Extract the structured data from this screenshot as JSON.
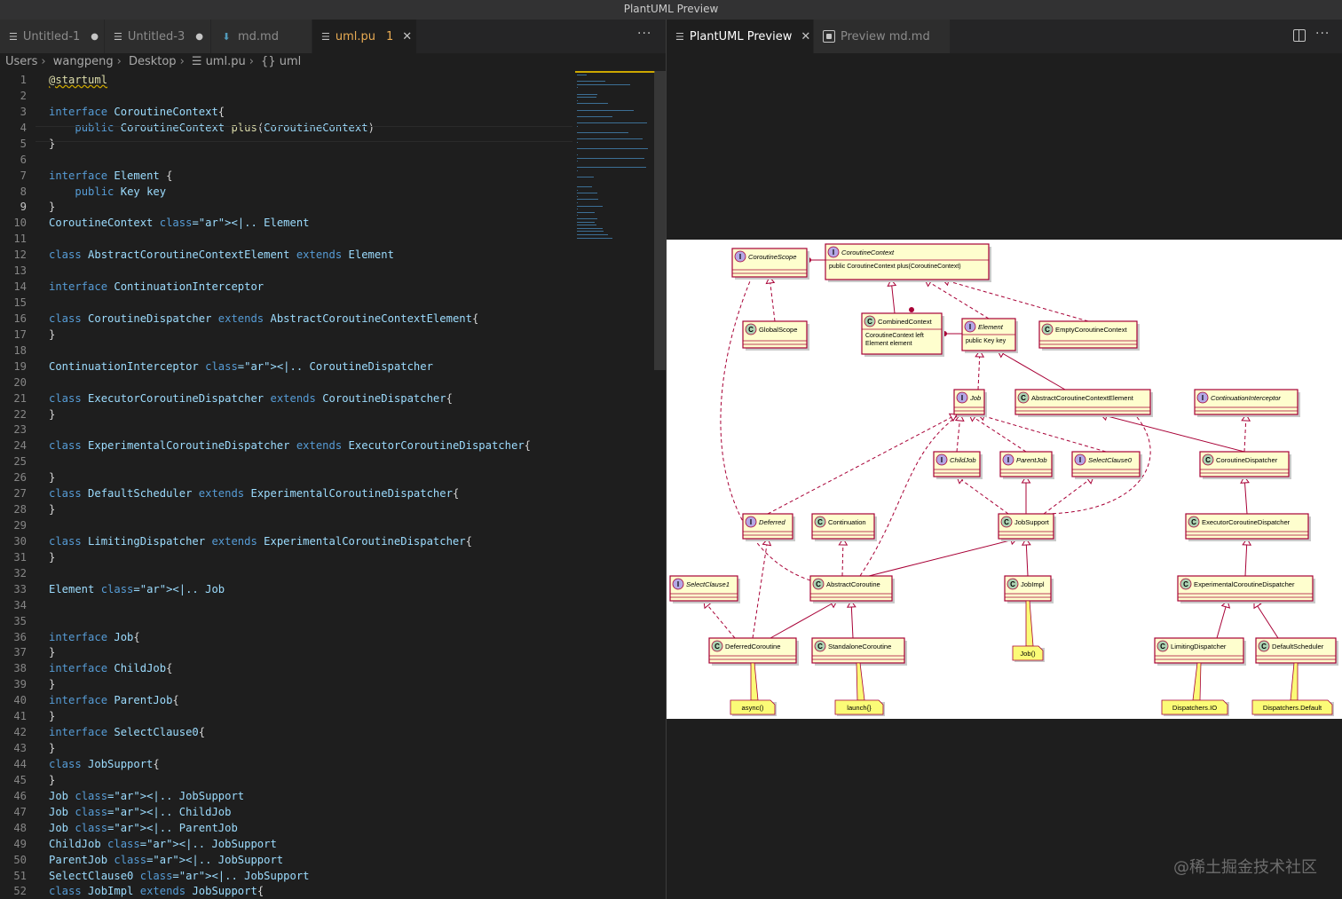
{
  "window": {
    "title": "PlantUML Preview"
  },
  "left_tabs": [
    {
      "label": "Untitled-1",
      "badge": "●"
    },
    {
      "label": "Untitled-3",
      "badge": "●"
    },
    {
      "label": "md.md",
      "badge": ""
    },
    {
      "label": "uml.pu",
      "badge": "1"
    }
  ],
  "right_tabs": [
    {
      "label": "PlantUML Preview"
    },
    {
      "label": "Preview md.md"
    }
  ],
  "breadcrumb": [
    "Users",
    "wangpeng",
    "Desktop",
    "uml.pu",
    "{} uml"
  ],
  "editor": {
    "current_line": "9",
    "lines": [
      "@startuml",
      "",
      "interface CoroutineContext{",
      "    public CoroutineContext plus(CoroutineContext)",
      "}",
      "",
      "interface Element {",
      "    public Key key",
      "}",
      "CoroutineContext <|.. Element",
      "",
      "class AbstractCoroutineContextElement extends Element",
      "",
      "interface ContinuationInterceptor",
      "",
      "class CoroutineDispatcher extends AbstractCoroutineContextElement{",
      "}",
      "",
      "ContinuationInterceptor <|.. CoroutineDispatcher",
      "",
      "class ExecutorCoroutineDispatcher extends CoroutineDispatcher{",
      "}",
      "",
      "class ExperimentalCoroutineDispatcher extends ExecutorCoroutineDispatcher{",
      "",
      "}",
      "class DefaultScheduler extends ExperimentalCoroutineDispatcher{",
      "}",
      "",
      "class LimitingDispatcher extends ExperimentalCoroutineDispatcher{",
      "}",
      "",
      "Element <|.. Job",
      "",
      "",
      "interface Job{",
      "}",
      "interface ChildJob{",
      "}",
      "interface ParentJob{",
      "}",
      "interface SelectClause0{",
      "}",
      "class JobSupport{",
      "}",
      "Job <|.. JobSupport",
      "Job <|.. ChildJob",
      "Job <|.. ParentJob",
      "ChildJob <|.. JobSupport",
      "ParentJob <|.. JobSupport",
      "SelectClause0 <|.. JobSupport",
      "class JobImpl extends JobSupport{"
    ]
  },
  "diagram": {
    "nodes": [
      {
        "id": "CoroutineScope",
        "kind": "I",
        "name": "CoroutineScope"
      },
      {
        "id": "CoroutineContext",
        "kind": "I",
        "name": "CoroutineContext",
        "member": "public CoroutineContext plus(CoroutineContext)"
      },
      {
        "id": "GlobalScope",
        "kind": "C",
        "name": "GlobalScope"
      },
      {
        "id": "CombinedContext",
        "kind": "C",
        "name": "CombinedContext",
        "member": "CoroutineContext left",
        "member2": "Element element"
      },
      {
        "id": "Element",
        "kind": "I",
        "name": "Element",
        "member": "public Key key"
      },
      {
        "id": "EmptyCoroutineContext",
        "kind": "C",
        "name": "EmptyCoroutineContext"
      },
      {
        "id": "Job",
        "kind": "I",
        "name": "Job"
      },
      {
        "id": "AbstractCoroutineContextElement",
        "kind": "C",
        "name": "AbstractCoroutineContextElement"
      },
      {
        "id": "ContinuationInterceptor",
        "kind": "I",
        "name": "ContinuationInterceptor"
      },
      {
        "id": "ChildJob",
        "kind": "I",
        "name": "ChildJob"
      },
      {
        "id": "ParentJob",
        "kind": "I",
        "name": "ParentJob"
      },
      {
        "id": "SelectClause0",
        "kind": "I",
        "name": "SelectClause0"
      },
      {
        "id": "CoroutineDispatcher",
        "kind": "C",
        "name": "CoroutineDispatcher"
      },
      {
        "id": "Deferred",
        "kind": "I",
        "name": "Deferred"
      },
      {
        "id": "Continuation",
        "kind": "C",
        "name": "Continuation"
      },
      {
        "id": "JobSupport",
        "kind": "C",
        "name": "JobSupport"
      },
      {
        "id": "ExecutorCoroutineDispatcher",
        "kind": "C",
        "name": "ExecutorCoroutineDispatcher"
      },
      {
        "id": "SelectClause1",
        "kind": "I",
        "name": "SelectClause1"
      },
      {
        "id": "AbstractCoroutine",
        "kind": "C",
        "name": "AbstractCoroutine"
      },
      {
        "id": "JobImpl",
        "kind": "C",
        "name": "JobImpl"
      },
      {
        "id": "ExperimentalCoroutineDispatcher",
        "kind": "C",
        "name": "ExperimentalCoroutineDispatcher"
      },
      {
        "id": "DeferredCoroutine",
        "kind": "C",
        "name": "DeferredCoroutine"
      },
      {
        "id": "StandaloneCoroutine",
        "kind": "C",
        "name": "StandaloneCoroutine"
      },
      {
        "id": "LimitingDispatcher",
        "kind": "C",
        "name": "LimitingDispatcher"
      },
      {
        "id": "DefaultScheduler",
        "kind": "C",
        "name": "DefaultScheduler"
      }
    ],
    "notes": [
      "async()",
      "launch{}",
      "Job()",
      "Dispatchers.IO",
      "Dispatchers.Default"
    ]
  },
  "watermark": "@稀土掘金技术社区",
  "colors": {
    "accent": "#e8ab53",
    "uml_fill": "#fefece",
    "uml_line": "#a80036",
    "note_fill": "#fbfb77"
  }
}
